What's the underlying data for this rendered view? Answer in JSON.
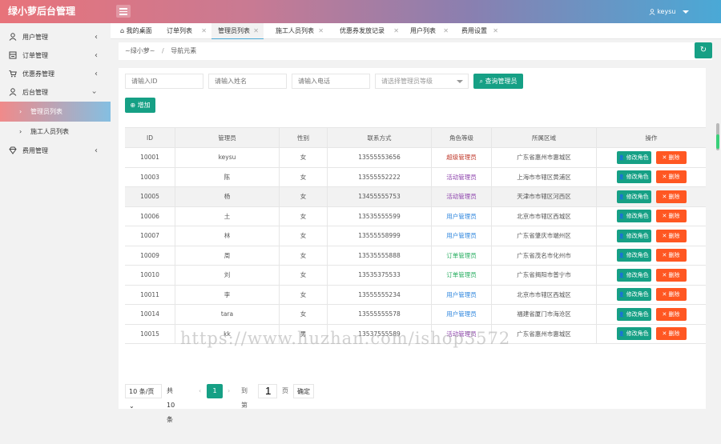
{
  "app": {
    "title": "绿小萝后台管理",
    "user": "keysu"
  },
  "sidebar": {
    "items": [
      {
        "label": "用户管理",
        "icon": "user-icon"
      },
      {
        "label": "订单管理",
        "icon": "order-icon"
      },
      {
        "label": "优惠券管理",
        "icon": "cart-icon"
      },
      {
        "label": "后台管理",
        "icon": "admin-icon"
      }
    ],
    "sub": [
      {
        "label": "管理员列表"
      },
      {
        "label": "施工人员列表"
      }
    ],
    "last": {
      "label": "费用管理",
      "icon": "gem-icon"
    }
  },
  "tabs": [
    {
      "label": "我的桌面"
    },
    {
      "label": "订单列表"
    },
    {
      "label": "管理员列表"
    },
    {
      "label": "施工人员列表"
    },
    {
      "label": "优惠券发放记录"
    },
    {
      "label": "用户列表"
    },
    {
      "label": "费用设置"
    }
  ],
  "breadcrumb": {
    "home": "~绿小萝~",
    "current": "导航元素"
  },
  "filters": {
    "id_placeholder": "请输入ID",
    "name_placeholder": "请输入姓名",
    "phone_placeholder": "请输入电话",
    "level_placeholder": "请选择管理员等级",
    "query_label": "查询管理员",
    "add_label": "增加"
  },
  "table": {
    "headers": [
      "ID",
      "管理员",
      "性别",
      "联系方式",
      "角色等级",
      "所属区域",
      "操作"
    ],
    "edit_label": "修改角色",
    "delete_label": "删除",
    "rows": [
      {
        "id": "10001",
        "name": "keysu",
        "gender": "女",
        "phone": "13555553656",
        "role": "超级管理员",
        "role_color": "#c0392b",
        "region": "广东省惠州市惠城区"
      },
      {
        "id": "10003",
        "name": "陈",
        "gender": "女",
        "phone": "13555552222",
        "role": "活动管理员",
        "role_color": "#8e44ad",
        "region": "上海市市辖区黄浦区"
      },
      {
        "id": "10005",
        "name": "杨",
        "gender": "女",
        "phone": "13455555753",
        "role": "活动管理员",
        "role_color": "#8e44ad",
        "region": "天津市市辖区河西区"
      },
      {
        "id": "10006",
        "name": "土",
        "gender": "女",
        "phone": "13535555599",
        "role": "用户管理员",
        "role_color": "#2e86de",
        "region": "北京市市辖区西城区"
      },
      {
        "id": "10007",
        "name": "林",
        "gender": "女",
        "phone": "13555558999",
        "role": "用户管理员",
        "role_color": "#2e86de",
        "region": "广东省肇庆市端州区"
      },
      {
        "id": "10009",
        "name": "周",
        "gender": "女",
        "phone": "13535555888",
        "role": "订单管理员",
        "role_color": "#27ae60",
        "region": "广东省茂名市化州市"
      },
      {
        "id": "10010",
        "name": "刘",
        "gender": "女",
        "phone": "13535375533",
        "role": "订单管理员",
        "role_color": "#27ae60",
        "region": "广东省揭阳市普宁市"
      },
      {
        "id": "10011",
        "name": "李",
        "gender": "女",
        "phone": "13555555234",
        "role": "用户管理员",
        "role_color": "#2e86de",
        "region": "北京市市辖区西城区"
      },
      {
        "id": "10014",
        "name": "tara",
        "gender": "女",
        "phone": "13555555578",
        "role": "用户管理员",
        "role_color": "#2e86de",
        "region": "福建省厦门市海沧区"
      },
      {
        "id": "10015",
        "name": "kk",
        "gender": "男",
        "phone": "13537555589",
        "role": "活动管理员",
        "role_color": "#8e44ad",
        "region": "广东省惠州市惠城区"
      }
    ]
  },
  "pager": {
    "page_size": "10 条/页",
    "total": "共 10 条",
    "current": "1",
    "goto_label": "到第",
    "goto_value": "1",
    "page_suffix": "页",
    "ok_label": "确定"
  },
  "watermark": "https://www.huzhan.com/ishop3572",
  "colors": {
    "accent": "#16a085",
    "danger": "#ff5722"
  }
}
